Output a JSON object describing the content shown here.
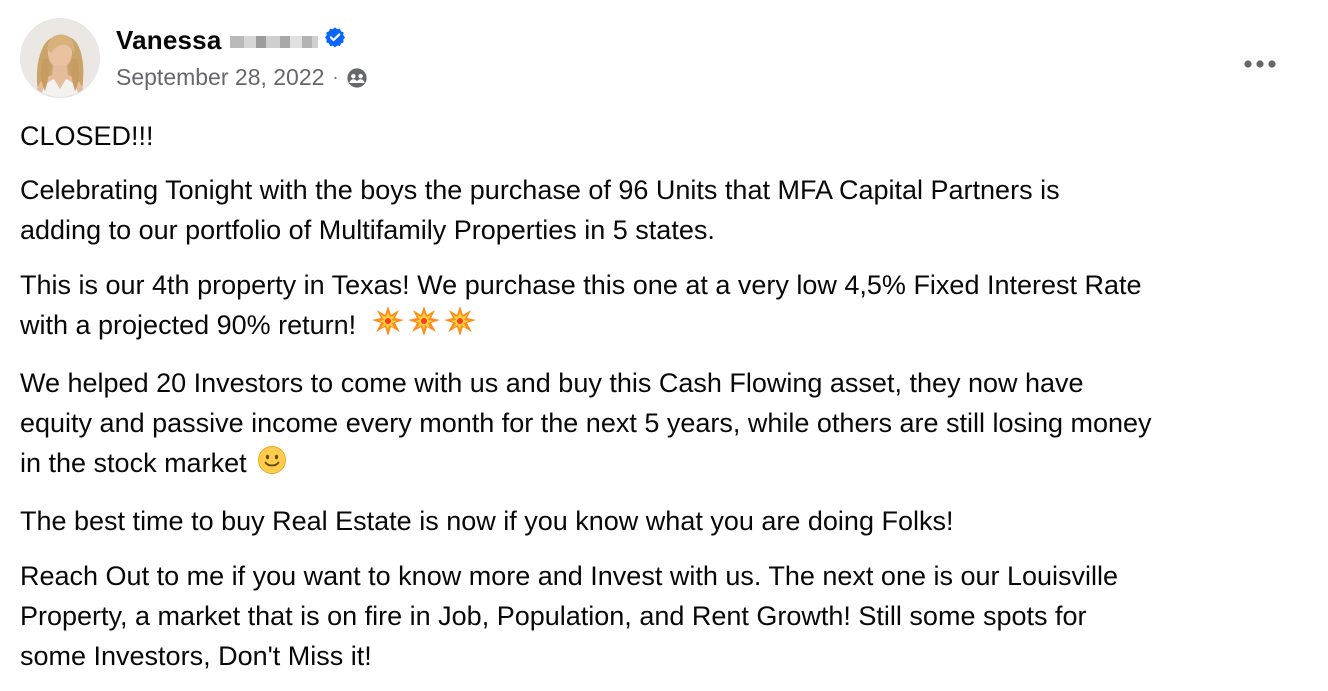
{
  "post": {
    "author": {
      "name": "Vanessa"
    },
    "date": "September 28, 2022",
    "separator": "·",
    "icons": {
      "avatar": "profile-photo",
      "verified": "verified-badge-icon",
      "audience": "friends-audience-icon",
      "more": "more-options-icon",
      "explosion": "collision-emoji",
      "smile": "slightly-smiling-face-emoji"
    },
    "colors": {
      "verified_blue": "#0866ff",
      "secondary_text": "#65676b",
      "primary_text": "#080809"
    },
    "paragraphs": [
      "CLOSED!!!",
      "Celebrating Tonight with the boys the purchase of 96 Units that MFA Capital Partners is\nadding to our portfolio of Multifamily Properties in 5 states.",
      "This is our 4th property in Texas! We purchase this one at a very low 4,5% Fixed Interest Rate\nwith a projected 90% return!",
      "We helped 20 Investors to come with us and buy this Cash Flowing asset, they now have\nequity and passive income every month for the next 5 years, while others are still losing money\nin the stock market",
      "The best time to buy  Real Estate is now if you know what you are doing Folks!",
      "Reach Out to me if you want to know more and Invest with us. The next one is our Louisville\nProperty, a market that is on fire in Job, Population, and Rent Growth!  Still some spots for\nsome Investors, Don't Miss it!"
    ]
  }
}
